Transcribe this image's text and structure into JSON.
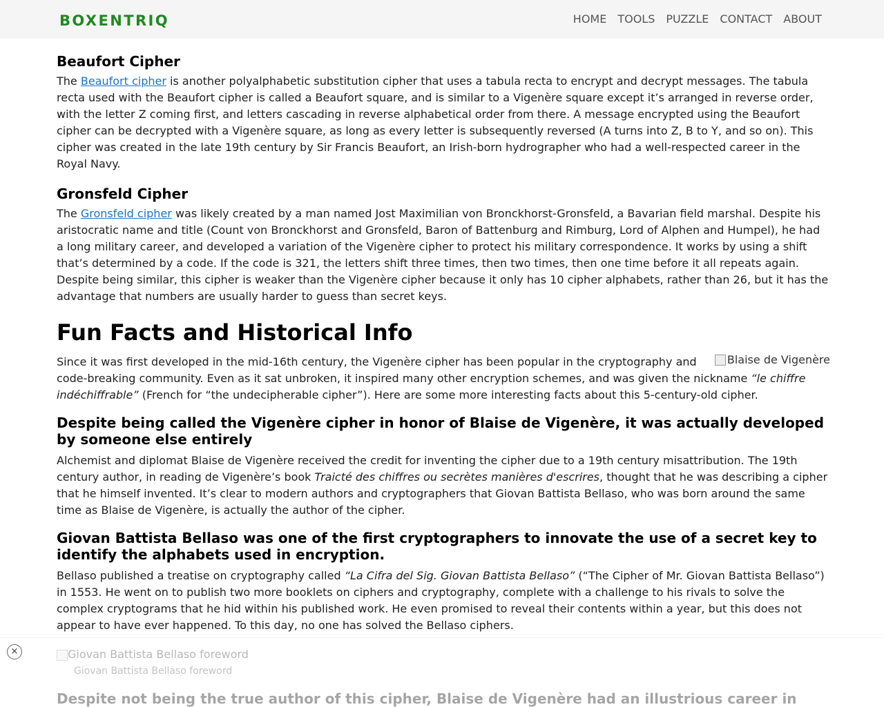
{
  "header": {
    "logo": "BOXENTRIQ",
    "nav": [
      "HOME",
      "TOOLS",
      "PUZZLE",
      "CONTACT",
      "ABOUT"
    ]
  },
  "beaufort": {
    "heading": "Beaufort Cipher",
    "pre": "The ",
    "link": "Beaufort cipher",
    "post": " is another polyalphabetic substitution cipher that uses a tabula recta to encrypt and decrypt messages. The tabula recta used with the Beaufort cipher is called a Beaufort square, and is similar to a Vigenère square except it’s arranged in reverse order, with the letter Z coming first, and letters cascading in reverse alphabetical order from there. A message encrypted using the Beaufort cipher can be decrypted with a Vigenère square, as long as every letter is subsequently reversed (A turns into Z, B to Y, and so on). This cipher was created in the late 19th century by Sir Francis Beaufort, an Irish-born hydrographer who had a well-respected career in the Royal Navy."
  },
  "gronsfeld": {
    "heading": "Gronsfeld Cipher",
    "pre": "The ",
    "link": "Gronsfeld cipher",
    "post": " was likely created by a man named Jost Maximilian von Bronckhorst-Gronsfeld, a Bavarian field marshal. Despite his aristocratic name and title (Count von Bronckhorst and Gronsfeld, Baron of Battenburg and Rimburg, Lord of Alphen and Humpel), he had a long military career, and developed a variation of the Vigenère cipher to protect his military correspondence. It works by using a shift that’s determined by a code. If the code is 321, the letters shift three times, then two times, then one time before it all repeats again. Despite being similar, this cipher is weaker than the Vigenère cipher because it only has 10 cipher alphabets, rather than 26, but it has the advantage that numbers are usually harder to guess than secret keys."
  },
  "fun": {
    "heading": "Fun Facts and Historical Info",
    "image_alt": "Blaise de Vigenère",
    "p1": "Since it was first developed in the mid-16th century, the Vigenère cipher has been popular in the cryptography and code-breaking community. Even as it sat unbroken, it inspired many other encryption schemes, and was given the nickname ",
    "p_italic": "“le chiffre indéchiffrable”",
    "p2": " (French for “the undecipherable cipher”). Here are some more interesting facts about this 5-century-old cipher."
  },
  "fact1": {
    "heading": "Despite being called the Vigenère cipher in honor of Blaise de Vigenère, it was actually developed by someone else entirely",
    "p1": "Alchemist and diplomat Blaise de Vigenère received the credit for inventing the cipher due to a 19th century misattribution. The 19th century author, in reading de Vigenère’s book ",
    "p_italic": "Traicté des chiffres ou secrètes manières d'escrires",
    "p2": ", thought that he was describing a cipher that he himself invented. It’s clear to modern authors and cryptographers that Giovan Battista Bellaso, who was born around the same time as Blaise de Vigenère, is actually the author of the cipher."
  },
  "fact2": {
    "heading": "Giovan Battista Bellaso was one of the first cryptographers to innovate the use of a secret key to identify the alphabets used in encryption.",
    "p1": "Bellaso published a treatise on cryptography called ",
    "p_italic": "“La Cifra del Sig. Giovan Battista Bellaso”",
    "p2": " (“The Cipher of Mr. Giovan Battista Bellaso”) in 1553. He went on to publish two more booklets on ciphers and cryptography, complete with a challenge to his rivals to solve the complex cryptograms that he hid within his published work. He even promised to reveal their contents within a year, but this does not appear to have ever happened. To this day, no one has solved the Bellaso ciphers."
  },
  "footer_fade": {
    "image_alt": "Giovan Battista Bellaso foreword",
    "caption": "Giovan Battista Bellaso foreword",
    "next_heading": "Despite not being the true author of this cipher, Blaise de Vigenère had an illustrious career in"
  },
  "close_label": "×"
}
